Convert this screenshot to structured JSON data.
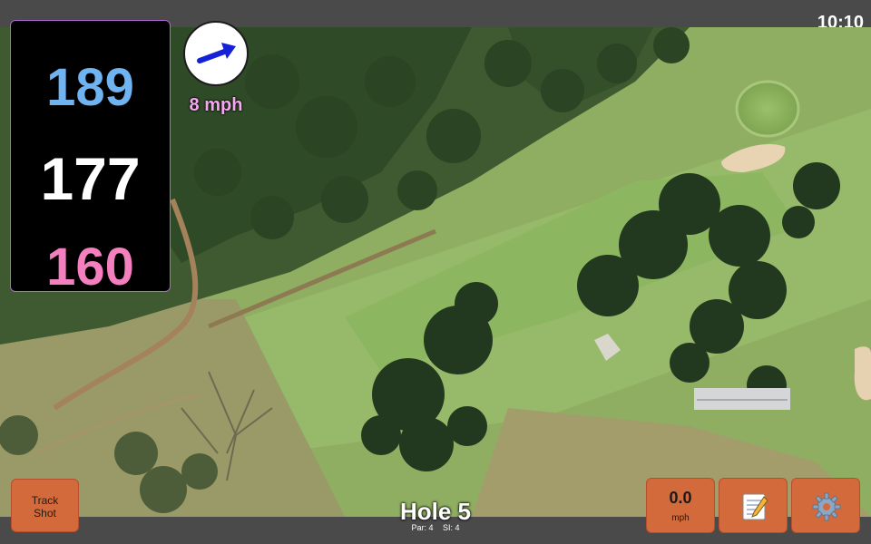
{
  "status_bar": {
    "time": "10:10"
  },
  "distances": {
    "back": "189",
    "middle": "177",
    "front": "160"
  },
  "wind": {
    "speed": "8 mph",
    "direction_icon": "arrow-icon"
  },
  "buttons": {
    "track_shot": "Track Shot",
    "speed_value": "0.0",
    "speed_unit": "mph",
    "notes_icon": "notepad-icon",
    "settings_icon": "gear-icon"
  },
  "hole": {
    "title": "Hole 5",
    "par": "Par: 4",
    "si": "SI: 4"
  },
  "colors": {
    "back_distance": "#6fb3f0",
    "middle_distance": "#ffffff",
    "front_distance": "#f47fbf",
    "wind_text": "#f7a6f2",
    "button": "#d26a3c",
    "bar": "#4a4a4a"
  }
}
